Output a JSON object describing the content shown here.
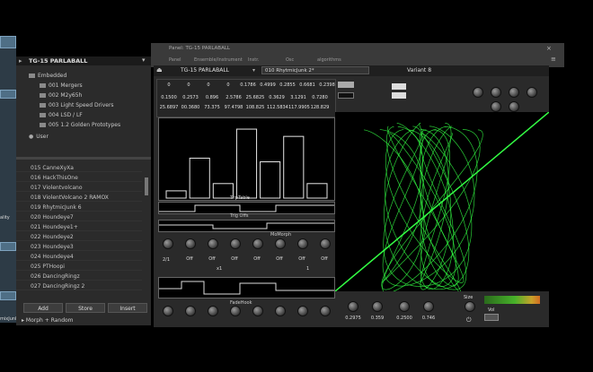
{
  "window": {
    "title": "Panel TG-15 PARLABALL"
  },
  "left_strip": {
    "label1": "ality",
    "label2": "mixJunk"
  },
  "browser": {
    "header": "TG-15 PARLABALL",
    "tree": [
      {
        "label": "Embedded"
      },
      {
        "label": "001 Mergers"
      },
      {
        "label": "002 M2y65h"
      },
      {
        "label": "003 Light Speed Drivers"
      },
      {
        "label": "004 LSD / LF"
      },
      {
        "label": "005 1.2 Golden Prototypes"
      },
      {
        "label": "User"
      }
    ],
    "patches": [
      "015  CanneXyXa",
      "016  HackThisOne",
      "017  Violentvolcano",
      "018  ViolentVolcano 2 RAMOX",
      "019  RhytmicJunk 6",
      "020  Houndeye7",
      "021  Houndeye1+",
      "022  Houndeye2",
      "023  Houndeye3",
      "024  Houndeye4",
      "025  PTHoopi",
      "026  DancingRingz",
      "027  DancingRingz 2"
    ],
    "buttons": {
      "add": "Add",
      "store": "Store",
      "insert": "Insert"
    },
    "footer": "Morph + Random"
  },
  "topbar": {
    "panel_label": "Panel: TG-15 PARLABALL",
    "path": [
      "Panel",
      "Ensemble/Instrument",
      "Instr.",
      "Osc",
      "algorithms"
    ]
  },
  "editor": {
    "header_name": "TG-15 PARLABALL",
    "preset": "010  RhytmicJunk 2*",
    "variant": "Variant 8",
    "row_top": [
      "0",
      "0",
      "0",
      "0",
      "0.1786",
      "0.4999",
      "0.2855",
      "0.6681",
      "0.2398"
    ],
    "row_mid": [
      "0.1500",
      "0.2573",
      "0.896",
      "2.5786",
      "25.6825",
      "0.3629",
      "3.1291",
      "0.7280"
    ],
    "row_bot": [
      "25.6897",
      "00.3680",
      "73.375",
      "97.4798",
      "108.825",
      "112.5834",
      "117.9905",
      "128.829"
    ],
    "section_labels": {
      "table": "TripTable",
      "trig": "Trig Offs",
      "morph": "MoMorph",
      "fade": "FadeHook"
    },
    "bottom_values": [
      "0.2975",
      "0.359",
      "0.2500",
      "0.746"
    ],
    "toggle_labels": [
      "Off",
      "Off",
      "Off",
      "Off",
      "Off",
      "Off",
      "Off"
    ],
    "mini_labels": [
      "2/1",
      "x1",
      "1"
    ],
    "right_knob_label": "Size",
    "vol_label": "Vol"
  },
  "colors": {
    "accent_green": "#33ff44",
    "panel_gray": "#2a2a2a",
    "display_black": "#000000"
  },
  "chart_data": {
    "type": "bar",
    "categories": [
      "1",
      "2",
      "3",
      "4",
      "5",
      "6",
      "7"
    ],
    "values": [
      0.1,
      0.55,
      0.2,
      0.95,
      0.5,
      0.85,
      0.2
    ],
    "ylim": [
      0,
      1
    ]
  }
}
